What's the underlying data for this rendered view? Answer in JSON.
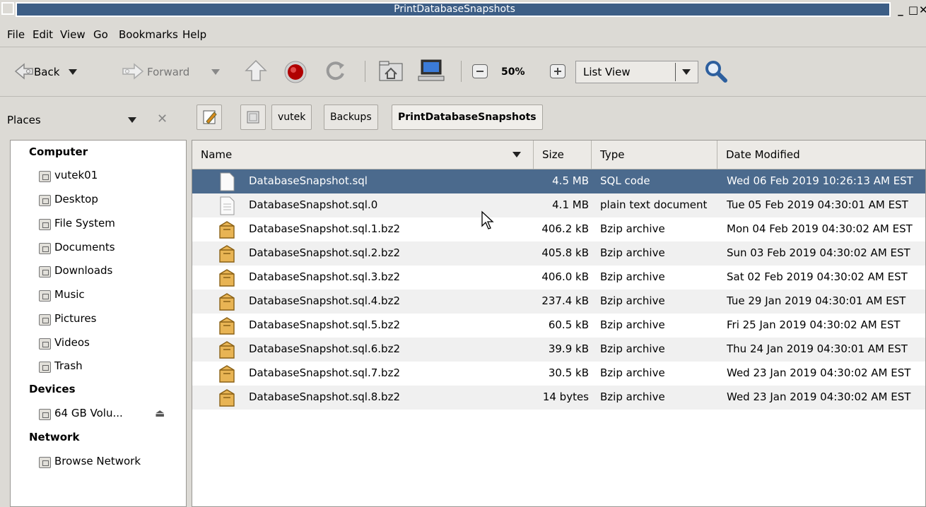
{
  "window": {
    "title": "PrintDatabaseSnapshots"
  },
  "menu": [
    "File",
    "Edit",
    "View",
    "Go",
    "Bookmarks",
    "Help"
  ],
  "toolbar": {
    "back_label": "Back",
    "forward_label": "Forward",
    "zoom_level": "50%",
    "view_mode": "List View"
  },
  "places": {
    "header": "Places",
    "sections": {
      "computer": "Computer",
      "devices": "Devices",
      "network": "Network"
    },
    "computer_items": [
      "vutek01",
      "Desktop",
      "File System",
      "Documents",
      "Downloads",
      "Music",
      "Pictures",
      "Videos",
      "Trash"
    ],
    "device_items": [
      "64 GB Volu..."
    ],
    "network_items": [
      "Browse Network"
    ]
  },
  "breadcrumb": [
    "vutek",
    "Backups",
    "PrintDatabaseSnapshots"
  ],
  "columns": {
    "name": "Name",
    "size": "Size",
    "type": "Type",
    "date": "Date Modified"
  },
  "files": [
    {
      "name": "DatabaseSnapshot.sql",
      "size": "4.5 MB",
      "type": "SQL code",
      "date": "Wed 06 Feb 2019 10:26:13 AM EST",
      "icon": "sql-file-icon"
    },
    {
      "name": "DatabaseSnapshot.sql.0",
      "size": "4.1 MB",
      "type": "plain text document",
      "date": "Tue 05 Feb 2019 04:30:01 AM EST",
      "icon": "text-file-icon"
    },
    {
      "name": "DatabaseSnapshot.sql.1.bz2",
      "size": "406.2 kB",
      "type": "Bzip archive",
      "date": "Mon 04 Feb 2019 04:30:02 AM EST",
      "icon": "archive-icon"
    },
    {
      "name": "DatabaseSnapshot.sql.2.bz2",
      "size": "405.8 kB",
      "type": "Bzip archive",
      "date": "Sun 03 Feb 2019 04:30:02 AM EST",
      "icon": "archive-icon"
    },
    {
      "name": "DatabaseSnapshot.sql.3.bz2",
      "size": "406.0 kB",
      "type": "Bzip archive",
      "date": "Sat 02 Feb 2019 04:30:02 AM EST",
      "icon": "archive-icon"
    },
    {
      "name": "DatabaseSnapshot.sql.4.bz2",
      "size": "237.4 kB",
      "type": "Bzip archive",
      "date": "Tue 29 Jan 2019 04:30:01 AM EST",
      "icon": "archive-icon"
    },
    {
      "name": "DatabaseSnapshot.sql.5.bz2",
      "size": "60.5 kB",
      "type": "Bzip archive",
      "date": "Fri 25 Jan 2019 04:30:02 AM EST",
      "icon": "archive-icon"
    },
    {
      "name": "DatabaseSnapshot.sql.6.bz2",
      "size": "39.9 kB",
      "type": "Bzip archive",
      "date": "Thu 24 Jan 2019 04:30:01 AM EST",
      "icon": "archive-icon"
    },
    {
      "name": "DatabaseSnapshot.sql.7.bz2",
      "size": "30.5 kB",
      "type": "Bzip archive",
      "date": "Wed 23 Jan 2019 04:30:02 AM EST",
      "icon": "archive-icon"
    },
    {
      "name": "DatabaseSnapshot.sql.8.bz2",
      "size": "14 bytes",
      "type": "Bzip archive",
      "date": "Wed 23 Jan 2019 04:30:02 AM EST",
      "icon": "archive-icon"
    }
  ],
  "colors": {
    "titlebar": "#3d5e86",
    "selection": "#4b6a8d",
    "archive_icon": "#e8b454"
  }
}
